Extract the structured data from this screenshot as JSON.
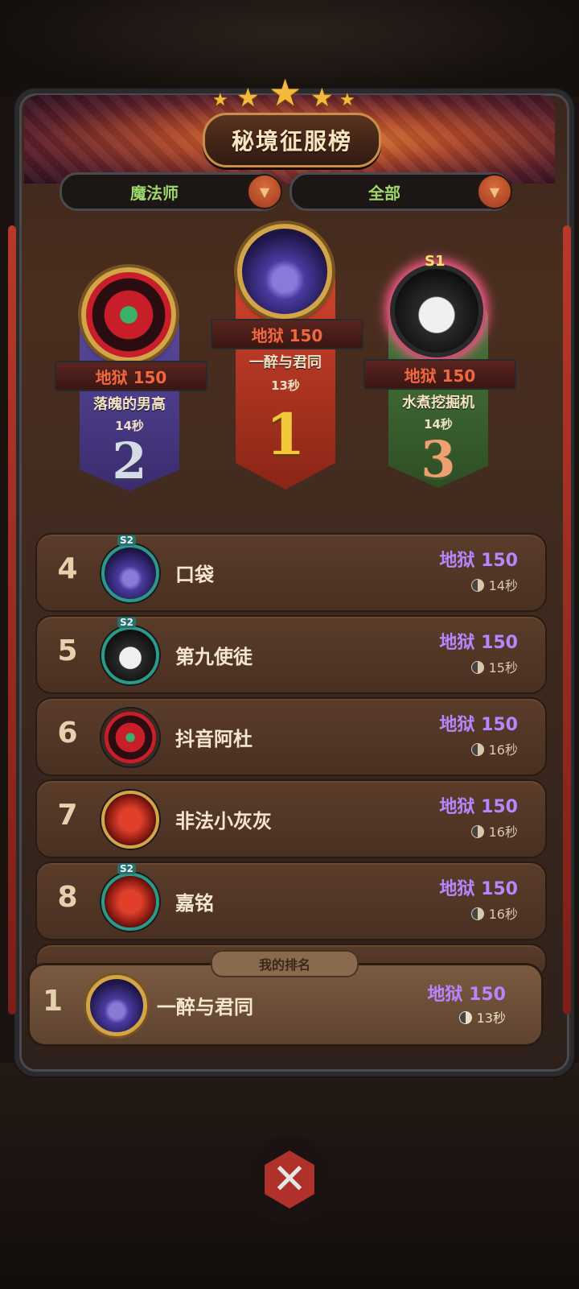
{
  "header": {
    "title": "秘境征服榜"
  },
  "filters": {
    "class": "魔法师",
    "scope": "全部"
  },
  "podium": [
    {
      "rank": "2",
      "score": "地狱 150",
      "name": "落魄的男高",
      "time": "14秒"
    },
    {
      "rank": "1",
      "score": "地狱 150",
      "name": "一醉与君同",
      "time": "13秒"
    },
    {
      "rank": "3",
      "score": "地狱 150",
      "name": "水煮挖掘机",
      "time": "14秒",
      "badge": "S1"
    }
  ],
  "list": [
    {
      "rank": "4",
      "name": "口袋",
      "score": "地狱 150",
      "time": "14秒",
      "badge": "S2"
    },
    {
      "rank": "5",
      "name": "第九使徒",
      "score": "地狱 150",
      "time": "15秒",
      "badge": "S2"
    },
    {
      "rank": "6",
      "name": "抖音阿杜",
      "score": "地狱 150",
      "time": "16秒"
    },
    {
      "rank": "7",
      "name": "非法小灰灰",
      "score": "地狱 150",
      "time": "16秒"
    },
    {
      "rank": "8",
      "name": "嘉铭",
      "score": "地狱 150",
      "time": "16秒",
      "badge": "S2"
    }
  ],
  "my_rank": {
    "tag": "我的排名",
    "rank": "1",
    "name": "一醉与君同",
    "score": "地狱 150",
    "time": "13秒"
  },
  "colors": {
    "score_purple": "#b786ff",
    "hell_red": "#f2673f",
    "gold": "#d2a548"
  }
}
